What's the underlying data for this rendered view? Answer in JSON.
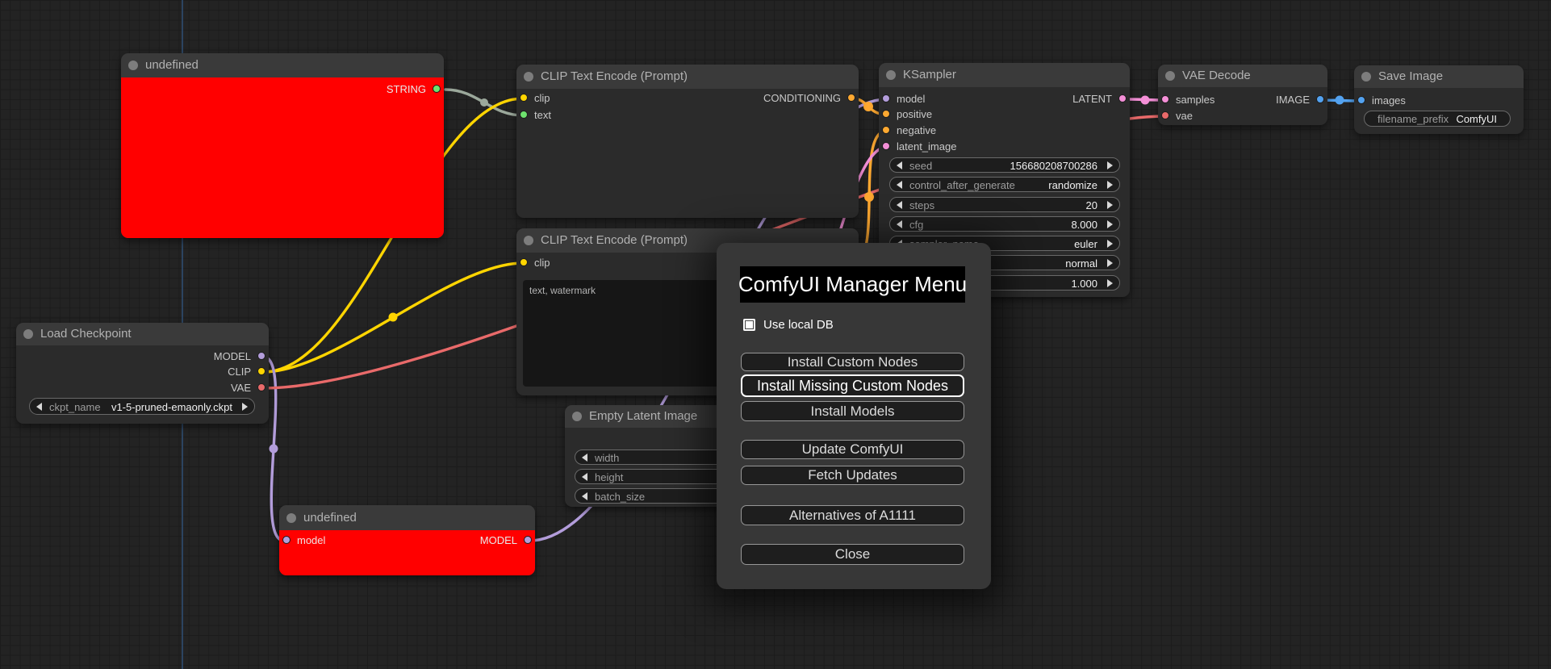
{
  "colors": {
    "string_dot": "#6EE26E",
    "string_wire": "#9BA89B",
    "clip": "#FFD500",
    "conditioning": "#FFA931",
    "model": "#B39DDB",
    "latent": "#F48FD7",
    "vae": "#E96A6A",
    "image": "#53A2F0",
    "node_error_bg": "#FF0000",
    "title_dot": "#7d7d7d"
  },
  "nodes": {
    "undefinedString": {
      "title": "undefined",
      "output": "STRING"
    },
    "clipEncode1": {
      "title": "CLIP Text Encode (Prompt)",
      "inputs": [
        "clip",
        "text"
      ],
      "output": "CONDITIONING"
    },
    "clipEncode2": {
      "title": "CLIP Text Encode (Prompt)",
      "input": "clip",
      "prompt_text": "text, watermark"
    },
    "ksampler": {
      "title": "KSampler",
      "inputs": [
        "model",
        "positive",
        "negative",
        "latent_image"
      ],
      "output": "LATENT",
      "widgets": [
        {
          "label": "seed",
          "value": "156680208700286"
        },
        {
          "label": "control_after_generate",
          "value": "randomize"
        },
        {
          "label": "steps",
          "value": "20"
        },
        {
          "label": "cfg",
          "value": "8.000"
        },
        {
          "label": "sampler_name",
          "value": "euler"
        },
        {
          "label": "",
          "value": "normal"
        },
        {
          "label": "",
          "value": "1.000"
        }
      ]
    },
    "vaeDecode": {
      "title": "VAE Decode",
      "inputs": [
        "samples",
        "vae"
      ],
      "output": "IMAGE"
    },
    "saveImage": {
      "title": "Save Image",
      "input": "images",
      "widget": {
        "label": "filename_prefix",
        "value": "ComfyUI"
      }
    },
    "loadCheckpoint": {
      "title": "Load Checkpoint",
      "outputs": [
        "MODEL",
        "CLIP",
        "VAE"
      ],
      "widget": {
        "label": "ckpt_name",
        "value": "v1-5-pruned-emaonly.ckpt"
      }
    },
    "emptyLatent": {
      "title": "Empty Latent Image",
      "widgets": [
        {
          "label": "width"
        },
        {
          "label": "height"
        },
        {
          "label": "batch_size"
        }
      ]
    },
    "undefinedModel": {
      "title": "undefined",
      "input": "model",
      "output": "MODEL"
    }
  },
  "dialog": {
    "title": "ComfyUI Manager Menu",
    "checkbox": {
      "label": "Use local DB",
      "checked": false
    },
    "buttons": [
      {
        "label": "Install Custom Nodes"
      },
      {
        "label": "Install Missing Custom Nodes"
      },
      {
        "label": "Install Models"
      },
      {
        "label": "Update ComfyUI"
      },
      {
        "label": "Fetch Updates"
      },
      {
        "label": "Alternatives of A1111"
      },
      {
        "label": "Close"
      }
    ]
  }
}
